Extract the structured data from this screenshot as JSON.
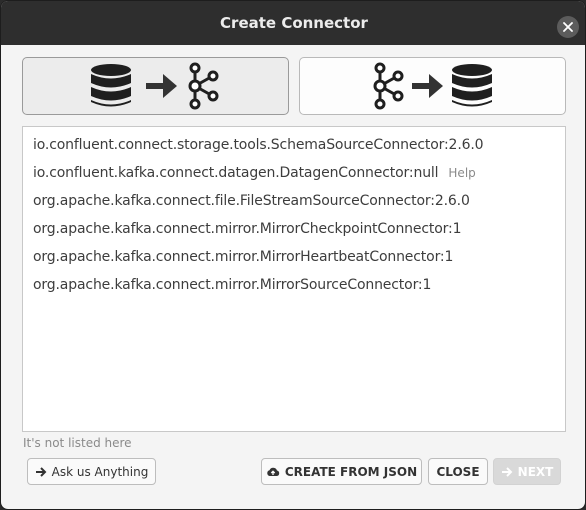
{
  "window": {
    "title": "Create Connector"
  },
  "modes": [
    {
      "name": "source",
      "icon": "database-to-kafka-icon",
      "selected": true
    },
    {
      "name": "sink",
      "icon": "kafka-to-database-icon",
      "selected": false
    }
  ],
  "connectors": [
    {
      "label": "io.confluent.connect.storage.tools.SchemaSourceConnector:2.6.0",
      "help": ""
    },
    {
      "label": "io.confluent.kafka.connect.datagen.DatagenConnector:null",
      "help": "Help"
    },
    {
      "label": "org.apache.kafka.connect.file.FileStreamSourceConnector:2.6.0",
      "help": ""
    },
    {
      "label": "org.apache.kafka.connect.mirror.MirrorCheckpointConnector:1",
      "help": ""
    },
    {
      "label": "org.apache.kafka.connect.mirror.MirrorHeartbeatConnector:1",
      "help": ""
    },
    {
      "label": "org.apache.kafka.connect.mirror.MirrorSourceConnector:1",
      "help": ""
    }
  ],
  "hint": "It's not listed here",
  "buttons": {
    "ask": "Ask us Anything",
    "create_json": "CREATE FROM JSON",
    "close": "CLOSE",
    "next": "NEXT"
  },
  "icons": {
    "ask": "arrow-right-icon",
    "create_json": "cloud-upload-icon",
    "next": "arrow-right-icon",
    "close_window": "close-icon"
  },
  "colors": {
    "titlebar": "#2e2e2e",
    "icon_dark": "#1f1f1f",
    "disabled_button": "#d9d9d9"
  }
}
